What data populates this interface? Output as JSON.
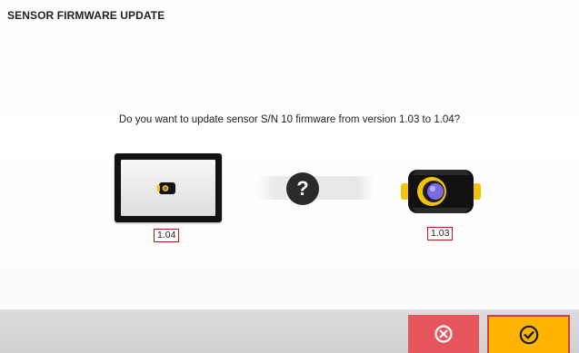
{
  "window": {
    "title": "SENSOR FIRMWARE UPDATE"
  },
  "dialog": {
    "question": "Do you want to update sensor S/N 10 firmware from version 1.03 to 1.04?",
    "new_version": "1.04",
    "current_version": "1.03",
    "status_glyph": "?"
  },
  "icons": {
    "device": "tablet-device-icon",
    "sensor": "sensor-icon",
    "status": "question-mark-icon",
    "cancel": "close-circle-icon",
    "confirm": "checkmark-circle-icon"
  },
  "colors": {
    "cancel_button": "#e5565d",
    "confirm_button": "#ffb400",
    "version_border": "#b51c1c",
    "sensor_accent": "#f2c300"
  }
}
